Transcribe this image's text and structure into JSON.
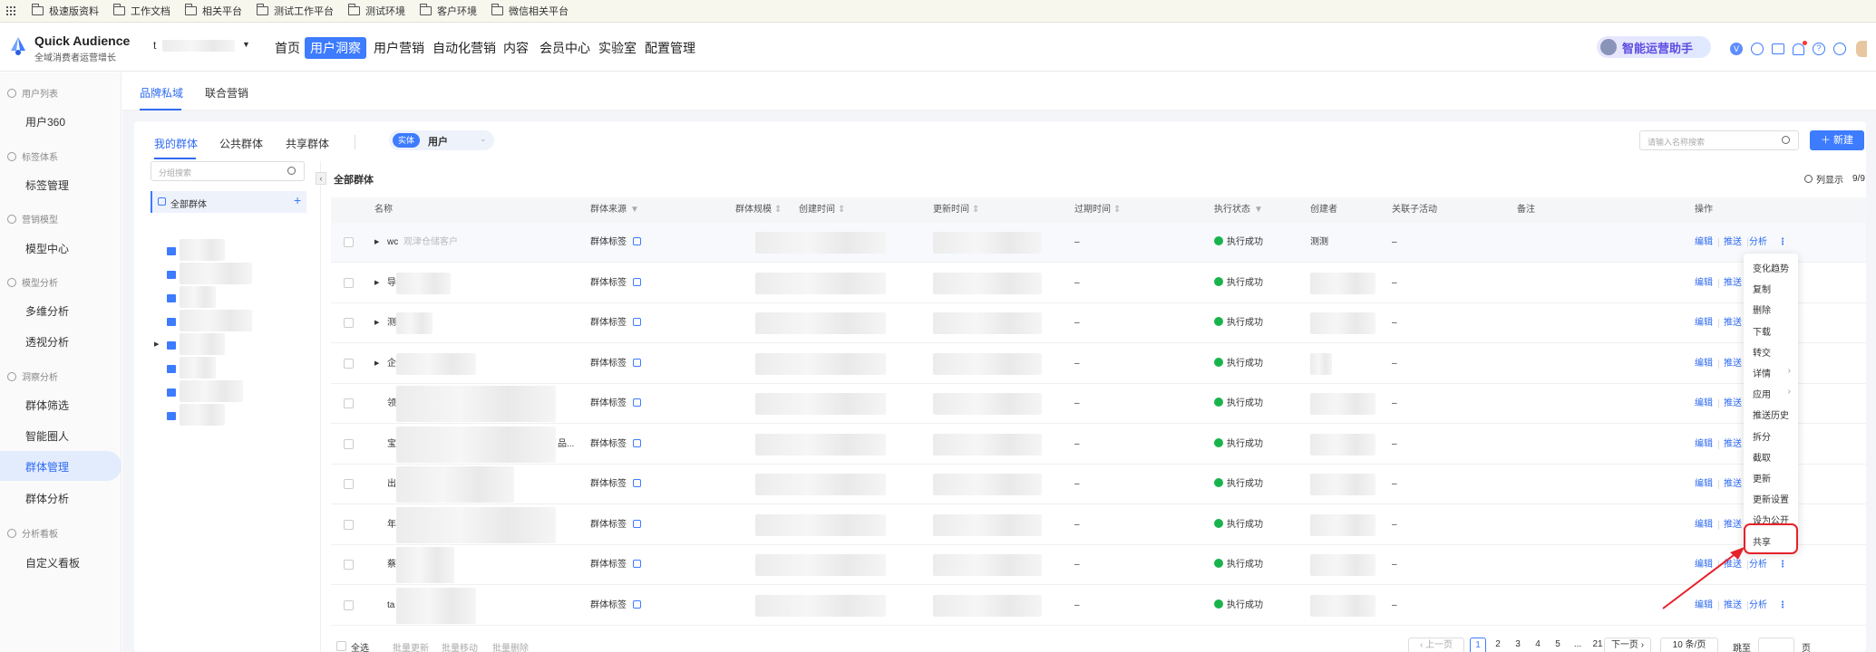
{
  "bookmarks": [
    "极速版资料",
    "工作文档",
    "相关平台",
    "测试工作平台",
    "测试环境",
    "客户环境",
    "微信相关平台"
  ],
  "app": {
    "title": "Quick Audience",
    "subtitle": "全域消费者运营增长",
    "workspace_prefix": "t"
  },
  "top_nav": [
    "首页",
    "用户洞察",
    "用户营销",
    "自动化营销",
    "内容",
    "会员中心",
    "实验室",
    "配置管理"
  ],
  "assistant_label": "智能运营助手",
  "sidebar": {
    "sections": [
      {
        "title": "用户列表",
        "items": [
          "用户360"
        ]
      },
      {
        "title": "标签体系",
        "items": [
          "标签管理"
        ]
      },
      {
        "title": "营销模型",
        "items": [
          "模型中心"
        ]
      },
      {
        "title": "模型分析",
        "items": [
          "多维分析",
          "透视分析"
        ]
      },
      {
        "title": "洞察分析",
        "items": [
          "群体筛选",
          "智能圈人",
          "群体管理",
          "群体分析"
        ]
      },
      {
        "title": "分析看板",
        "items": [
          "自定义看板"
        ]
      }
    ],
    "active": "群体管理"
  },
  "sub_tabs": [
    "品牌私域",
    "联合营销"
  ],
  "group_tabs": [
    "我的群体",
    "公共群体",
    "共享群体"
  ],
  "entity": {
    "tag": "实体",
    "value": "用户"
  },
  "search": {
    "placeholder": "请输入名称搜索"
  },
  "new_button": "新建",
  "tree": {
    "search_placeholder": "分组搜索",
    "root": "全部群体",
    "add": "+"
  },
  "list_title": "全部群体",
  "column_display": "列显示",
  "column_count": "9/9",
  "columns": [
    "名称",
    "群体来源",
    "群体规模",
    "创建时间",
    "更新时间",
    "过期时间",
    "执行状态",
    "创建者",
    "关联子活动",
    "备注",
    "操作"
  ],
  "rows": [
    {
      "name_prefix": "wc",
      "name_suffix": "观津仓储客户",
      "source": "群体标签",
      "expire": "–",
      "status": "执行成功",
      "creator": "测测",
      "sub": "–"
    },
    {
      "name_prefix": "导",
      "name_suffix": "",
      "source": "群体标签",
      "expire": "–",
      "status": "执行成功",
      "creator": "",
      "sub": "–"
    },
    {
      "name_prefix": "测",
      "name_suffix": "",
      "source": "群体标签",
      "expire": "–",
      "status": "执行成功",
      "creator": "",
      "sub": "–"
    },
    {
      "name_prefix": "企",
      "name_suffix": "",
      "source": "群体标签",
      "expire": "–",
      "status": "执行成功",
      "creator": "",
      "sub": "–"
    },
    {
      "name_prefix": "领",
      "name_suffix": "",
      "source": "群体标签",
      "expire": "–",
      "status": "执行成功",
      "creator": "",
      "sub": "–"
    },
    {
      "name_prefix": "宝",
      "name_suffix": "品...",
      "source": "群体标签",
      "expire": "–",
      "status": "执行成功",
      "creator": "",
      "sub": "–"
    },
    {
      "name_prefix": "出",
      "name_suffix": "",
      "source": "群体标签",
      "expire": "–",
      "status": "执行成功",
      "creator": "",
      "sub": "–"
    },
    {
      "name_prefix": "年",
      "name_suffix": "",
      "source": "群体标签",
      "expire": "–",
      "status": "执行成功",
      "creator": "",
      "sub": "–"
    },
    {
      "name_prefix": "蔡",
      "name_suffix": "",
      "source": "群体标签",
      "expire": "–",
      "status": "执行成功",
      "creator": "",
      "sub": "–"
    },
    {
      "name_prefix": "ta",
      "name_suffix": "",
      "source": "群体标签",
      "expire": "–",
      "status": "执行成功",
      "creator": "",
      "sub": "–"
    }
  ],
  "row_actions": [
    "编辑",
    "推送",
    "分析"
  ],
  "more_menu": [
    "变化趋势",
    "复制",
    "删除",
    "下载",
    "转交",
    "详情",
    "应用",
    "推送历史",
    "拆分",
    "截取",
    "更新",
    "更新设置",
    "设为公开",
    "共享"
  ],
  "footer": {
    "select_all": "全选",
    "batch_update": "批量更新",
    "batch_move": "批量移动",
    "batch_delete": "批量删除",
    "prev": "上一页",
    "next": "下一页",
    "pages": [
      "1",
      "2",
      "3",
      "4",
      "5",
      "...",
      "21"
    ],
    "page_size": "10 条/页",
    "jump": "跳至",
    "page_unit": "页"
  },
  "colors": {
    "primary": "#3d7bff",
    "success": "#19b34c",
    "highlight": "#e6212a",
    "sidebar_active_bg": "#e3ecfd"
  }
}
